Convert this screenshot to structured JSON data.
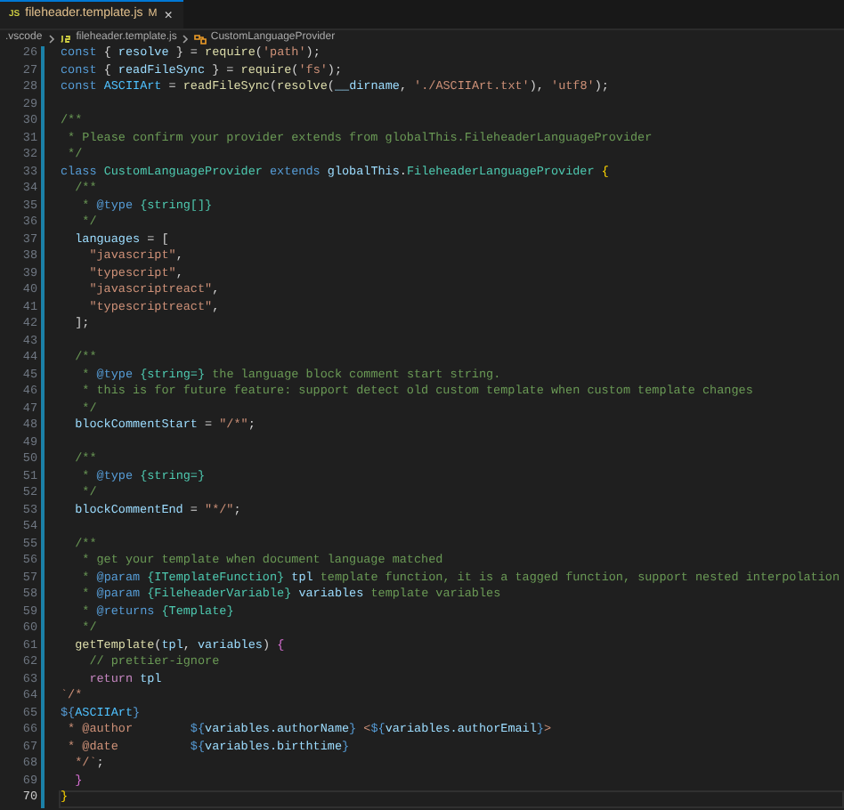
{
  "tab": {
    "icon": "JS",
    "label": "fileheader.template.js",
    "status": "M",
    "close": "×",
    "selected": true
  },
  "breadcrumbs": [
    {
      "label": ".vscode",
      "kind": "folder"
    },
    {
      "label": "fileheader.template.js",
      "kind": "file"
    },
    {
      "label": "CustomLanguageProvider",
      "kind": "symbol"
    }
  ],
  "lines": [
    {
      "number": "26",
      "current": false,
      "tokens": [
        {
          "text": "const",
          "kind": "kw"
        },
        {
          "text": " { ",
          "kind": "p"
        },
        {
          "text": "resolve",
          "kind": "var"
        },
        {
          "text": " } = ",
          "kind": "p"
        },
        {
          "text": "require",
          "kind": "fn"
        },
        {
          "text": "(",
          "kind": "p"
        },
        {
          "text": "'path'",
          "kind": "str"
        },
        {
          "text": ");",
          "kind": "p"
        }
      ]
    },
    {
      "number": "27",
      "current": false,
      "tokens": [
        {
          "text": "const",
          "kind": "kw"
        },
        {
          "text": " { ",
          "kind": "p"
        },
        {
          "text": "readFileSync",
          "kind": "var"
        },
        {
          "text": " } = ",
          "kind": "p"
        },
        {
          "text": "require",
          "kind": "fn"
        },
        {
          "text": "(",
          "kind": "p"
        },
        {
          "text": "'fs'",
          "kind": "str"
        },
        {
          "text": ");",
          "kind": "p"
        }
      ]
    },
    {
      "number": "28",
      "current": false,
      "tokens": [
        {
          "text": "const ",
          "kind": "kw"
        },
        {
          "text": "ASCIIArt",
          "kind": "const"
        },
        {
          "text": " = ",
          "kind": "p"
        },
        {
          "text": "readFileSync",
          "kind": "fn"
        },
        {
          "text": "(",
          "kind": "p"
        },
        {
          "text": "resolve",
          "kind": "fn"
        },
        {
          "text": "(",
          "kind": "p"
        },
        {
          "text": "__dirname",
          "kind": "var"
        },
        {
          "text": ", ",
          "kind": "p"
        },
        {
          "text": "'./ASCIIArt.txt'",
          "kind": "str"
        },
        {
          "text": "), ",
          "kind": "p"
        },
        {
          "text": "'utf8'",
          "kind": "str"
        },
        {
          "text": ");",
          "kind": "p"
        }
      ]
    },
    {
      "number": "29",
      "current": false
    },
    {
      "number": "30",
      "current": false,
      "tokens": [
        {
          "text": "/**",
          "kind": "cmt"
        }
      ]
    },
    {
      "number": "31",
      "current": false,
      "tokens": [
        {
          "text": " * Please confirm your provider extends from globalThis.FileheaderLanguageProvider",
          "kind": "cmt"
        }
      ]
    },
    {
      "number": "32",
      "current": false,
      "tokens": [
        {
          "text": " */",
          "kind": "cmt"
        }
      ]
    },
    {
      "number": "33",
      "current": false,
      "tokens": [
        {
          "text": "class ",
          "kind": "kw"
        },
        {
          "text": "CustomLanguageProvider ",
          "kind": "cls"
        },
        {
          "text": "extends ",
          "kind": "kw"
        },
        {
          "text": "globalThis",
          "kind": "var"
        },
        {
          "text": ".",
          "kind": "p"
        },
        {
          "text": "FileheaderLanguageProvider ",
          "kind": "cls"
        },
        {
          "text": "{",
          "kind": "brace"
        }
      ]
    },
    {
      "number": "34",
      "current": false,
      "tokens": [
        {
          "text": "  /**",
          "kind": "cmt"
        }
      ]
    },
    {
      "number": "35",
      "current": false,
      "tokens": [
        {
          "text": "   * ",
          "kind": "cmt"
        },
        {
          "text": "@type ",
          "kind": "tag"
        },
        {
          "text": "{string[]}",
          "kind": "type"
        }
      ]
    },
    {
      "number": "36",
      "current": false,
      "tokens": [
        {
          "text": "   */",
          "kind": "cmt"
        }
      ]
    },
    {
      "number": "37",
      "current": false,
      "tokens": [
        {
          "text": "  languages",
          "kind": "var"
        },
        {
          "text": " = [",
          "kind": "p"
        }
      ]
    },
    {
      "number": "38",
      "current": false,
      "tokens": [
        {
          "text": "    \"javascript\"",
          "kind": "str"
        },
        {
          "text": ",",
          "kind": "p"
        }
      ]
    },
    {
      "number": "39",
      "current": false,
      "tokens": [
        {
          "text": "    \"typescript\"",
          "kind": "str"
        },
        {
          "text": ",",
          "kind": "p"
        }
      ]
    },
    {
      "number": "40",
      "current": false,
      "tokens": [
        {
          "text": "    \"javascriptreact\"",
          "kind": "str"
        },
        {
          "text": ",",
          "kind": "p"
        }
      ]
    },
    {
      "number": "41",
      "current": false,
      "tokens": [
        {
          "text": "    \"typescriptreact\"",
          "kind": "str"
        },
        {
          "text": ",",
          "kind": "p"
        }
      ]
    },
    {
      "number": "42",
      "current": false,
      "tokens": [
        {
          "text": "  ];",
          "kind": "p"
        }
      ]
    },
    {
      "number": "43",
      "current": false
    },
    {
      "number": "44",
      "current": false,
      "tokens": [
        {
          "text": "  /**",
          "kind": "cmt"
        }
      ]
    },
    {
      "number": "45",
      "current": false,
      "tokens": [
        {
          "text": "   * ",
          "kind": "cmt"
        },
        {
          "text": "@type ",
          "kind": "tag"
        },
        {
          "text": "{string=}",
          "kind": "type"
        },
        {
          "text": " the language block comment start string.",
          "kind": "cmt"
        }
      ]
    },
    {
      "number": "46",
      "current": false,
      "tokens": [
        {
          "text": "   * this is for future feature: support detect old custom template when custom template changes",
          "kind": "cmt"
        }
      ]
    },
    {
      "number": "47",
      "current": false,
      "tokens": [
        {
          "text": "   */",
          "kind": "cmt"
        }
      ]
    },
    {
      "number": "48",
      "current": false,
      "tokens": [
        {
          "text": "  blockCommentStart",
          "kind": "var"
        },
        {
          "text": " = ",
          "kind": "p"
        },
        {
          "text": "\"/*\"",
          "kind": "str"
        },
        {
          "text": ";",
          "kind": "p"
        }
      ]
    },
    {
      "number": "49",
      "current": false
    },
    {
      "number": "50",
      "current": false,
      "tokens": [
        {
          "text": "  /**",
          "kind": "cmt"
        }
      ]
    },
    {
      "number": "51",
      "current": false,
      "tokens": [
        {
          "text": "   * ",
          "kind": "cmt"
        },
        {
          "text": "@type ",
          "kind": "tag"
        },
        {
          "text": "{string=}",
          "kind": "type"
        }
      ]
    },
    {
      "number": "52",
      "current": false,
      "tokens": [
        {
          "text": "   */",
          "kind": "cmt"
        }
      ]
    },
    {
      "number": "53",
      "current": false,
      "tokens": [
        {
          "text": "  blockCommentEnd",
          "kind": "var"
        },
        {
          "text": " = ",
          "kind": "p"
        },
        {
          "text": "\"*/\"",
          "kind": "str"
        },
        {
          "text": ";",
          "kind": "p"
        }
      ]
    },
    {
      "number": "54",
      "current": false
    },
    {
      "number": "55",
      "current": false,
      "tokens": [
        {
          "text": "  /**",
          "kind": "cmt"
        }
      ]
    },
    {
      "number": "56",
      "current": false,
      "tokens": [
        {
          "text": "   * get your template when document language matched",
          "kind": "cmt"
        }
      ]
    },
    {
      "number": "57",
      "current": false,
      "tokens": [
        {
          "text": "   * ",
          "kind": "cmt"
        },
        {
          "text": "@param ",
          "kind": "tag"
        },
        {
          "text": "{ITemplateFunction} ",
          "kind": "type"
        },
        {
          "text": "tpl",
          "kind": "var"
        },
        {
          "text": " template function, it is a tagged function, support nested interpolation",
          "kind": "cmt"
        }
      ]
    },
    {
      "number": "58",
      "current": false,
      "tokens": [
        {
          "text": "   * ",
          "kind": "cmt"
        },
        {
          "text": "@param ",
          "kind": "tag"
        },
        {
          "text": "{FileheaderVariable} ",
          "kind": "type"
        },
        {
          "text": "variables",
          "kind": "var"
        },
        {
          "text": " template variables",
          "kind": "cmt"
        }
      ]
    },
    {
      "number": "59",
      "current": false,
      "tokens": [
        {
          "text": "   * ",
          "kind": "cmt"
        },
        {
          "text": "@returns ",
          "kind": "tag"
        },
        {
          "text": "{Template}",
          "kind": "type"
        }
      ]
    },
    {
      "number": "60",
      "current": false,
      "tokens": [
        {
          "text": "   */",
          "kind": "cmt"
        }
      ]
    },
    {
      "number": "61",
      "current": false,
      "tokens": [
        {
          "text": "  getTemplate",
          "kind": "fn"
        },
        {
          "text": "(",
          "kind": "p"
        },
        {
          "text": "tpl",
          "kind": "var"
        },
        {
          "text": ", ",
          "kind": "p"
        },
        {
          "text": "variables",
          "kind": "var"
        },
        {
          "text": ") ",
          "kind": "p"
        },
        {
          "text": "{",
          "kind": "brace2"
        }
      ]
    },
    {
      "number": "62",
      "current": false,
      "tokens": [
        {
          "text": "    // prettier-ignore",
          "kind": "cmt"
        }
      ]
    },
    {
      "number": "63",
      "current": false,
      "tokens": [
        {
          "text": "    return ",
          "kind": "ctrl"
        },
        {
          "text": "tpl",
          "kind": "var"
        }
      ]
    },
    {
      "number": "64",
      "current": false,
      "tokens": [
        {
          "text": "`/*",
          "kind": "str"
        }
      ]
    },
    {
      "number": "65",
      "current": false,
      "tokens": [
        {
          "text": "${",
          "kind": "kw"
        },
        {
          "text": "ASCIIArt",
          "kind": "const"
        },
        {
          "text": "}",
          "kind": "kw"
        }
      ]
    },
    {
      "number": "66",
      "current": false,
      "tokens": [
        {
          "text": " * @author        ",
          "kind": "str"
        },
        {
          "text": "${",
          "kind": "kw"
        },
        {
          "text": "variables.authorName",
          "kind": "var"
        },
        {
          "text": "}",
          "kind": "kw"
        },
        {
          "text": " <",
          "kind": "str"
        },
        {
          "text": "${",
          "kind": "kw"
        },
        {
          "text": "variables.authorEmail",
          "kind": "var"
        },
        {
          "text": "}",
          "kind": "kw"
        },
        {
          "text": ">",
          "kind": "str"
        }
      ]
    },
    {
      "number": "67",
      "current": false,
      "tokens": [
        {
          "text": " * @date          ",
          "kind": "str"
        },
        {
          "text": "${",
          "kind": "kw"
        },
        {
          "text": "variables.birthtime",
          "kind": "var"
        },
        {
          "text": "}",
          "kind": "kw"
        }
      ]
    },
    {
      "number": "68",
      "current": false,
      "tokens": [
        {
          "text": "  */`",
          "kind": "str"
        },
        {
          "text": ";",
          "kind": "p"
        }
      ]
    },
    {
      "number": "69",
      "current": false,
      "tokens": [
        {
          "text": "  }",
          "kind": "brace2"
        }
      ]
    },
    {
      "number": "70",
      "current": true,
      "tokens": [
        {
          "text": "}",
          "kind": "brace"
        }
      ]
    }
  ]
}
